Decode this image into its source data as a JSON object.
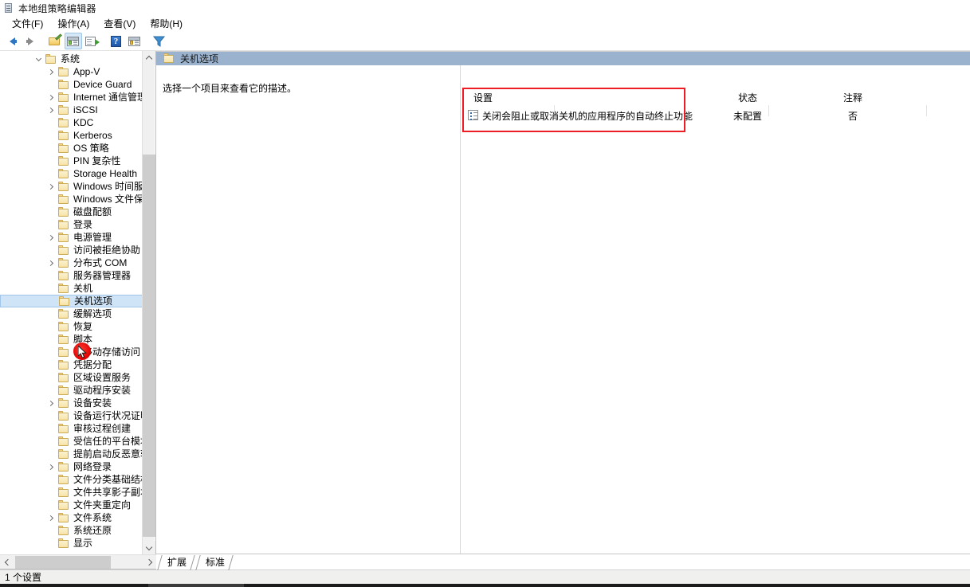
{
  "window": {
    "title": "本地组策略编辑器",
    "app_icon": "policy-editor-icon"
  },
  "menubar": {
    "items": [
      {
        "label": "文件(F)",
        "name": "menu-file"
      },
      {
        "label": "操作(A)",
        "name": "menu-action"
      },
      {
        "label": "查看(V)",
        "name": "menu-view"
      },
      {
        "label": "帮助(H)",
        "name": "menu-help"
      }
    ]
  },
  "toolbar": {
    "buttons": [
      {
        "name": "back-arrow-icon",
        "title": "后退"
      },
      {
        "name": "forward-arrow-icon",
        "title": "前进"
      },
      {
        "name": "up-folder-icon",
        "title": "上一层"
      },
      {
        "name": "show-console-tree-icon",
        "title": "显示/隐藏控制台树",
        "active": true
      },
      {
        "name": "export-list-icon",
        "title": "导出列表"
      },
      {
        "name": "help-icon",
        "title": "帮助"
      },
      {
        "name": "window-icon",
        "title": "显示/隐藏操作窗格"
      },
      {
        "name": "filter-icon",
        "title": "筛选器"
      }
    ]
  },
  "tree": {
    "items": [
      {
        "label": "系统",
        "level": 0,
        "expander": "open"
      },
      {
        "label": "App-V",
        "level": 1,
        "expander": "closed"
      },
      {
        "label": "Device Guard",
        "level": 1,
        "expander": "none"
      },
      {
        "label": "Internet 通信管理",
        "level": 1,
        "expander": "closed"
      },
      {
        "label": "iSCSI",
        "level": 1,
        "expander": "closed"
      },
      {
        "label": "KDC",
        "level": 1,
        "expander": "none"
      },
      {
        "label": "Kerberos",
        "level": 1,
        "expander": "none"
      },
      {
        "label": "OS 策略",
        "level": 1,
        "expander": "none"
      },
      {
        "label": "PIN 复杂性",
        "level": 1,
        "expander": "none"
      },
      {
        "label": "Storage Health",
        "level": 1,
        "expander": "none"
      },
      {
        "label": "Windows 时间服务",
        "level": 1,
        "expander": "closed"
      },
      {
        "label": "Windows 文件保护",
        "level": 1,
        "expander": "none"
      },
      {
        "label": "磁盘配额",
        "level": 1,
        "expander": "none"
      },
      {
        "label": "登录",
        "level": 1,
        "expander": "none"
      },
      {
        "label": "电源管理",
        "level": 1,
        "expander": "closed"
      },
      {
        "label": "访问被拒绝协助",
        "level": 1,
        "expander": "none"
      },
      {
        "label": "分布式 COM",
        "level": 1,
        "expander": "closed"
      },
      {
        "label": "服务器管理器",
        "level": 1,
        "expander": "none"
      },
      {
        "label": "关机",
        "level": 1,
        "expander": "none"
      },
      {
        "label": "关机选项",
        "level": 1,
        "expander": "none",
        "selected": true
      },
      {
        "label": "缓解选项",
        "level": 1,
        "expander": "none"
      },
      {
        "label": "恢复",
        "level": 1,
        "expander": "none"
      },
      {
        "label": "脚本",
        "level": 1,
        "expander": "none"
      },
      {
        "label": "可移动存储访问",
        "level": 1,
        "expander": "none"
      },
      {
        "label": "凭据分配",
        "level": 1,
        "expander": "none"
      },
      {
        "label": "区域设置服务",
        "level": 1,
        "expander": "none"
      },
      {
        "label": "驱动程序安装",
        "level": 1,
        "expander": "none"
      },
      {
        "label": "设备安装",
        "level": 1,
        "expander": "closed"
      },
      {
        "label": "设备运行状况证明服务",
        "level": 1,
        "expander": "none"
      },
      {
        "label": "审核过程创建",
        "level": 1,
        "expander": "none"
      },
      {
        "label": "受信任的平台模块服务",
        "level": 1,
        "expander": "none"
      },
      {
        "label": "提前启动反恶意软件",
        "level": 1,
        "expander": "none"
      },
      {
        "label": "网络登录",
        "level": 1,
        "expander": "closed"
      },
      {
        "label": "文件分类基础结构",
        "level": 1,
        "expander": "none"
      },
      {
        "label": "文件共享影子副本提供程序",
        "level": 1,
        "expander": "none"
      },
      {
        "label": "文件夹重定向",
        "level": 1,
        "expander": "none"
      },
      {
        "label": "文件系统",
        "level": 1,
        "expander": "closed"
      },
      {
        "label": "系统还原",
        "level": 1,
        "expander": "none"
      },
      {
        "label": "显示",
        "level": 1,
        "expander": "none"
      }
    ]
  },
  "right_panel": {
    "header_title": "关机选项",
    "description_placeholder": "选择一个项目来查看它的描述。",
    "columns": [
      {
        "key": "setting",
        "label": "设置"
      },
      {
        "key": "state",
        "label": "状态"
      },
      {
        "key": "comment",
        "label": "注释"
      }
    ],
    "rows": [
      {
        "setting": "关闭会阻止或取消关机的应用程序的自动终止功能",
        "state": "未配置",
        "comment": "否",
        "icon": "policy-setting-icon"
      }
    ]
  },
  "bottom_tabs": [
    {
      "label": "扩展",
      "name": "tab-extended"
    },
    {
      "label": "标准",
      "name": "tab-standard"
    }
  ],
  "statusbar": {
    "text": "1 个设置"
  },
  "annotation": {
    "highlight_color": "#ee1c25",
    "cursor_marker_color": "#e00000"
  }
}
